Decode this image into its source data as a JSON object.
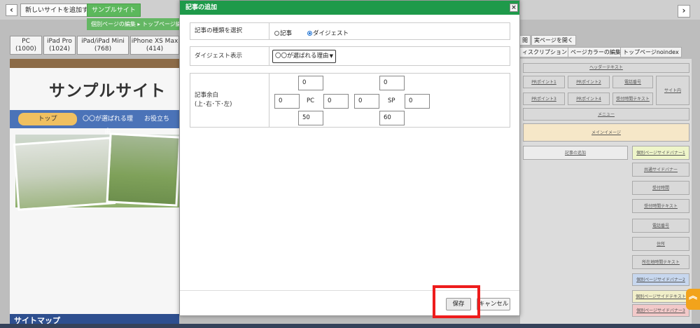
{
  "toolbar": {
    "add_site_label": "新しいサイトを追加する",
    "site_name": "サンプルサイト",
    "breadcrumb": "個別ページの編集 ▸ トップページ編"
  },
  "devices": [
    {
      "name": "PC",
      "width": "(1000)"
    },
    {
      "name": "iPad Pro",
      "width": "(1024)"
    },
    {
      "name": "iPad/iPad Mini",
      "width": "(768)"
    },
    {
      "name": "iPhone XS Max",
      "width": "(414)"
    }
  ],
  "preview": {
    "site_title": "サンプルサイト",
    "nav": [
      "トップ",
      "〇〇が選ばれる理由",
      "お役立ち"
    ],
    "sitemap": "サイトマップ"
  },
  "right_tabs": [
    "閲",
    "実ページを開く",
    "ィスクリプション",
    "ページカラーの編集",
    "トップページnoindex"
  ],
  "layout_blocks": {
    "header_text": "ヘッダーテキスト",
    "pr1": "PRポイント1",
    "pr2": "PRポイント2",
    "phone": "電話番号",
    "pr3": "PRポイント3",
    "pr4": "PRポイント4",
    "reception_text": "受付時間テキスト",
    "site_id": "サイト内",
    "menu": "メニュー",
    "main_image": "メインイメージ",
    "add_article": "記事の追加",
    "side_banner1": "個別ページサイドバナー1",
    "common_banner": "共通サイドバナー",
    "reception_time": "受付時間",
    "reception_text2": "受付時間テキスト",
    "phone2": "電話番号",
    "address": "住所",
    "sub_reception": "所在地時間テキスト",
    "side_banner2": "個別ページサイドバナー2",
    "side_text": "個別ページサイドテキスト",
    "side_banner3": "個別ページサイドバナー3"
  },
  "modal": {
    "title": "記事の追加",
    "close": "×",
    "row1": {
      "label": "記事の種類を選択",
      "options": [
        {
          "label": "記事",
          "selected": false
        },
        {
          "label": "ダイジェスト",
          "selected": true
        }
      ]
    },
    "row2": {
      "label": "ダイジェスト表示",
      "selected": "〇〇が選ばれる理由"
    },
    "row3": {
      "label_line1": "記事余白",
      "label_line2": "(上･右･下･左)",
      "pc": {
        "label": "PC",
        "top": "0",
        "right": "0",
        "bottom": "50",
        "left": "0"
      },
      "sp": {
        "label": "SP",
        "top": "0",
        "right": "0",
        "bottom": "60",
        "left": "0"
      }
    },
    "save": "保存",
    "cancel": "キャンセル"
  },
  "colors": {
    "modal_header": "#1e9a4a",
    "highlight": "#ee1c1c",
    "nav_blue": "#4b73b8"
  }
}
